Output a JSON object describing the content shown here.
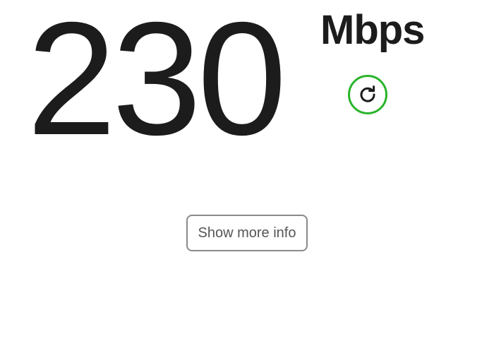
{
  "speed": {
    "value": "230",
    "units": "Mbps"
  },
  "refresh": {
    "icon": "refresh-icon",
    "accent_color": "#2ab42a"
  },
  "more_info": {
    "label": "Show more info"
  }
}
